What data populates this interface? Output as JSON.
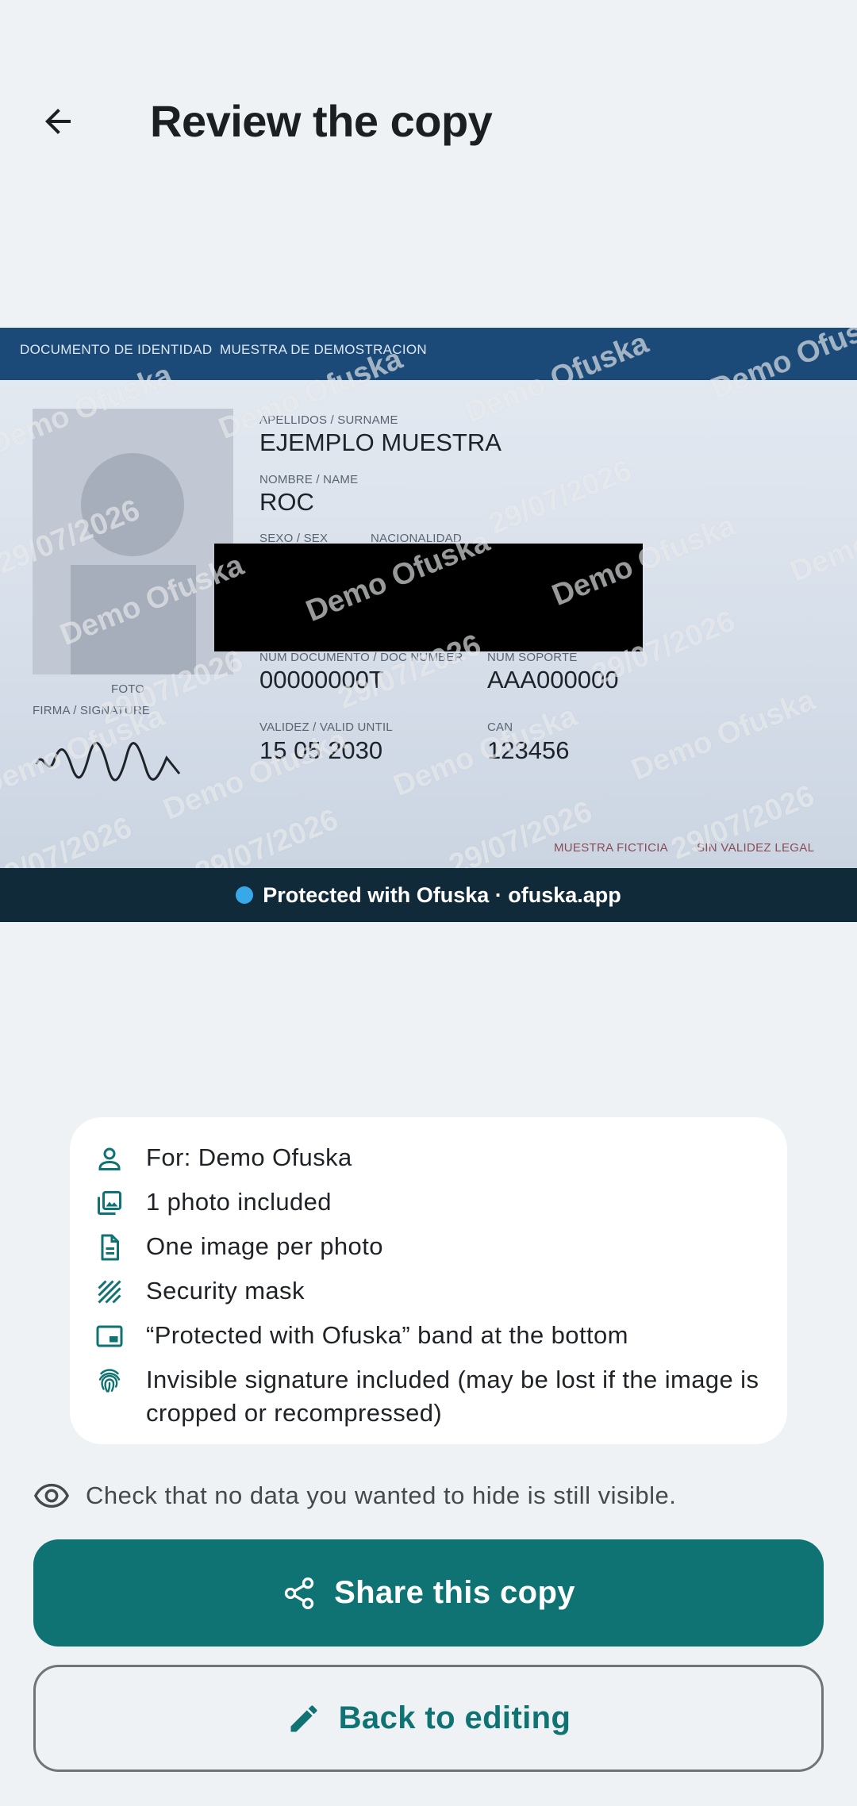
{
  "header": {
    "title": "Review the copy",
    "back_icon": "arrow-back-icon"
  },
  "id_card": {
    "header_left": "DOCUMENTO DE IDENTIDAD",
    "header_right": "MUESTRA DE DEMOSTRACION",
    "surname_label": "APELLIDOS / SURNAME",
    "surname_value": "EJEMPLO MUESTRA",
    "name_label": "NOMBRE / NAME",
    "name_value": "ROC",
    "sex_label": "SEXO / SEX",
    "nationality_label": "NACIONALIDAD",
    "doc_number_label": "NUM DOCUMENTO / DOC NUMBER",
    "doc_number_value": "00000000T",
    "support_label": "NUM SOPORTE",
    "support_value": "AAA000000",
    "photo_label": "FOTO",
    "signature_label": "FIRMA / SIGNATURE",
    "validity_label": "VALIDEZ / VALID UNTIL",
    "validity_value": "15 05 2030",
    "can_label": "CAN",
    "can_value": "123456",
    "footer_left": "MUESTRA FICTICIA",
    "footer_right": "SIN VALIDEZ LEGAL",
    "watermark_name": "Demo Ofuska",
    "watermark_date": "29/07/2026",
    "watermark_full": "Demo Ofuska · 29/07/2026"
  },
  "band": {
    "text": "Protected with Ofuska · ofuska.app",
    "dot_color": "#37a8e8"
  },
  "summary": {
    "items": [
      {
        "icon": "person-icon",
        "text": "For: Demo Ofuska"
      },
      {
        "icon": "photo-library-icon",
        "text": "1 photo included"
      },
      {
        "icon": "document-icon",
        "text": "One image per photo"
      },
      {
        "icon": "hatch-pattern-icon",
        "text": "Security mask"
      },
      {
        "icon": "bottom-band-icon",
        "text": "“Protected with Ofuska” band at the bottom"
      },
      {
        "icon": "fingerprint-icon",
        "text": "Invisible signature included (may be lost if the image is cropped or recompressed)"
      }
    ]
  },
  "hint": {
    "icon": "eye-icon",
    "text": "Check that no data you wanted to hide is still visible."
  },
  "actions": {
    "share_label": "Share this copy",
    "share_icon": "share-icon",
    "back_label": "Back to editing",
    "back_icon": "pencil-icon"
  },
  "colors": {
    "accent": "#0f7273",
    "background": "#eef2f4",
    "card_header": "#1b4a78",
    "band": "#102a3a"
  }
}
